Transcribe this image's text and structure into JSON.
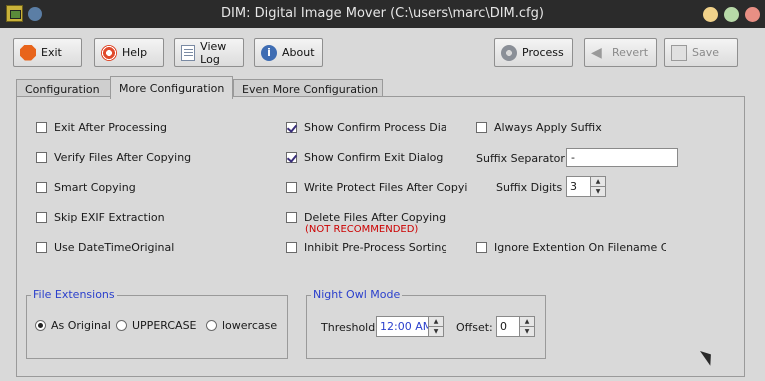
{
  "window": {
    "title": "DIM: Digital Image Mover (C:\\users\\marc\\DIM.cfg)"
  },
  "toolbar": {
    "exit": "Exit",
    "help": "Help",
    "view_log": "View Log",
    "about": "About",
    "process": "Process",
    "revert": "Revert",
    "save": "Save"
  },
  "tabs": [
    "Configuration",
    "More Configuration",
    "Even More Configuration"
  ],
  "active_tab": "More Configuration",
  "options": {
    "col1": [
      {
        "label": "Exit After Processing",
        "checked": false
      },
      {
        "label": "Verify Files After Copying",
        "checked": false
      },
      {
        "label": "Smart Copying",
        "checked": false
      },
      {
        "label": "Skip EXIF Extraction",
        "checked": false
      },
      {
        "label": "Use DateTimeOriginal",
        "checked": false
      }
    ],
    "col2": [
      {
        "label": "Show Confirm Process Dialog",
        "checked": true
      },
      {
        "label": "Show Confirm Exit Dialog",
        "checked": true
      },
      {
        "label": "Write Protect Files After Copying",
        "checked": false
      },
      {
        "label": "Delete Files After Copying",
        "checked": false
      },
      {
        "label": "Inhibit Pre-Process Sorting",
        "checked": false
      }
    ],
    "delete_warning": "(NOT RECOMMENDED)",
    "always_apply_suffix": {
      "label": "Always Apply Suffix",
      "checked": false
    },
    "ignore_extension": {
      "label": "Ignore Extention On Filename Clash",
      "checked": false
    },
    "suffix_separator_label": "Suffix Separator",
    "suffix_separator_value": "-",
    "suffix_digits_label": "Suffix Digits",
    "suffix_digits_value": "3"
  },
  "file_extensions": {
    "legend": "File Extensions",
    "options": [
      "As Original",
      "UPPERCASE",
      "lowercase"
    ],
    "selected": "As Original"
  },
  "night_owl": {
    "legend": "Night Owl Mode",
    "threshold_label": "Threshold",
    "threshold_value": "12:00 AM",
    "offset_label": "Offset:",
    "offset_value": "0"
  },
  "colors": {
    "accent_text": "#2a3fcc",
    "warning": "#cc0000",
    "window_bg": "#d9d9d9",
    "titlebar_bg": "#2b2b2b"
  }
}
